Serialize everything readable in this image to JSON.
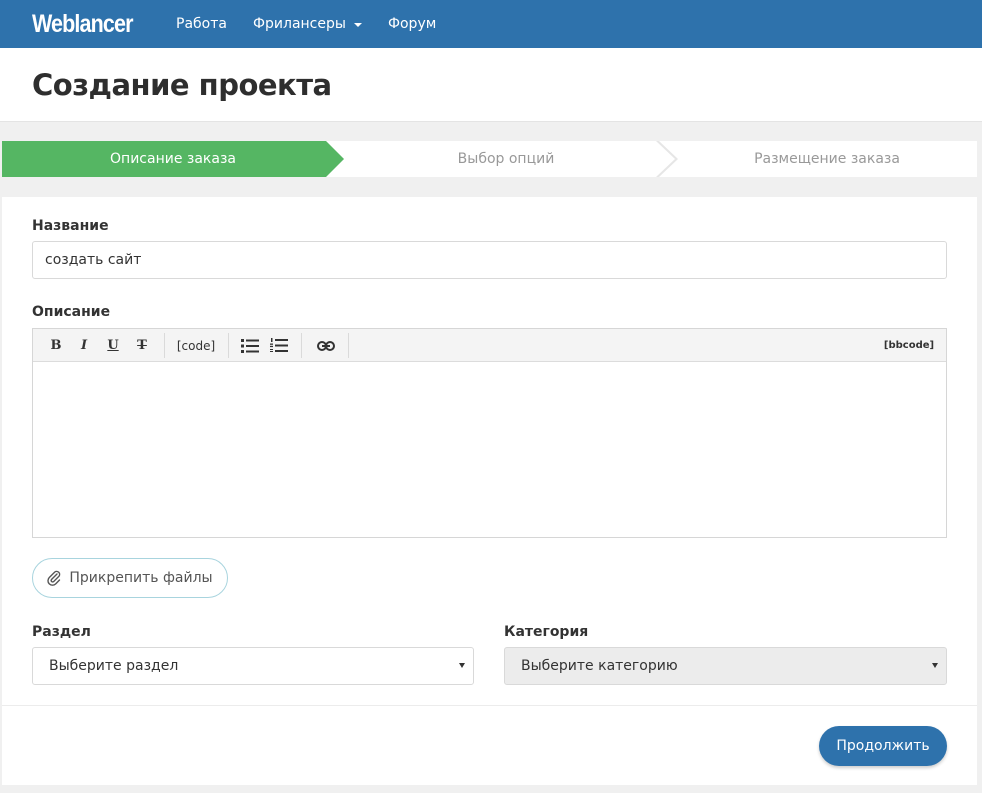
{
  "navbar": {
    "brand": "Weblancer",
    "links": [
      "Работа",
      "Фрилансеры",
      "Форум"
    ]
  },
  "page": {
    "title": "Создание проекта"
  },
  "steps": [
    {
      "label": "Описание заказа",
      "state": "active"
    },
    {
      "label": "Выбор опций",
      "state": "inactive"
    },
    {
      "label": "Размещение заказа",
      "state": "inactive"
    }
  ],
  "form": {
    "name_label": "Название",
    "name_value": "создать сайт",
    "description_label": "Описание",
    "toolbar": {
      "bold": "B",
      "italic": "I",
      "underline": "U",
      "strike": "T",
      "code": "[code]",
      "bbcode": "[bbcode]",
      "icons": [
        "bullet-list-icon",
        "numbered-list-icon",
        "link-icon"
      ]
    },
    "attach_label": "Прикрепить файлы",
    "section_label": "Раздел",
    "section_value": "Выберите раздел",
    "category_label": "Категория",
    "category_value": "Выберите категорию",
    "continue_label": "Продолжить"
  },
  "colors": {
    "navbar": "#2e72ac",
    "step_active": "#55b663",
    "button_primary": "#2e72ac",
    "disabled_select": "#ececec"
  }
}
